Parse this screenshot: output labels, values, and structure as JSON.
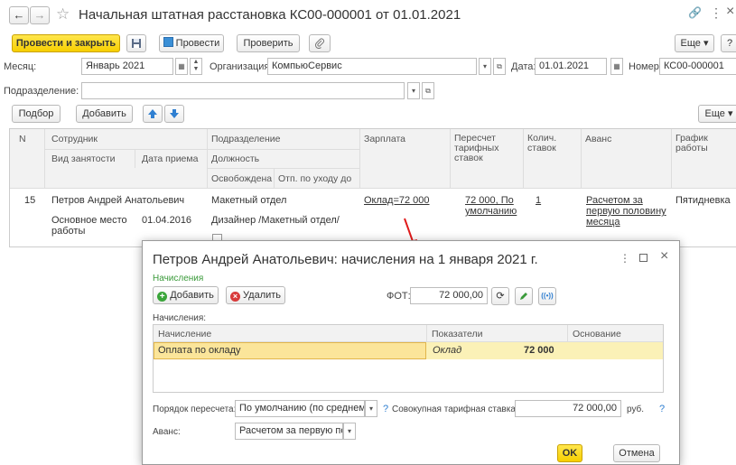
{
  "window": {
    "title": "Начальная штатная расстановка КС00-000001 от 01.01.2021",
    "nav_back": "←",
    "nav_forward": "→",
    "star": "☆",
    "link_icon": "🔗",
    "more_icon": "⋮",
    "close_icon": "×"
  },
  "toolbar": {
    "post_close": "Провести и закрыть",
    "save_icon": "save",
    "post": "Провести",
    "check": "Проверить",
    "attach_icon": "paperclip",
    "more": "Еще",
    "help": "?"
  },
  "header": {
    "month_label": "Месяц:",
    "month_value": "Январь 2021",
    "org_label": "Организация:",
    "org_value": "КомпьюСервис",
    "date_label": "Дата:",
    "date_value": "01.01.2021",
    "number_label": "Номер:",
    "number_value": "КС00-000001",
    "dept_label": "Подразделение:",
    "dept_value": ""
  },
  "table_toolbar": {
    "select": "Подбор",
    "add": "Добавить",
    "more": "Еще"
  },
  "table": {
    "headers": {
      "n": "N",
      "employee": "Сотрудник",
      "employment": "Вид занятости",
      "hire_date": "Дата приема",
      "department": "Подразделение",
      "position": "Должность",
      "vacated": "Освобождена",
      "leave": "Отп. по уходу до",
      "salary": "Зарплата",
      "recalc": "Пересчет тарифных ставок",
      "rates": "Колич. ставок",
      "advance": "Аванс",
      "schedule": "График работы"
    },
    "row": {
      "n": "15",
      "employee": "Петров Андрей Анатольевич",
      "employment": "Основное место работы",
      "hire_date": "01.04.2016",
      "department": "Макетный отдел",
      "position": "Дизайнер /Макетный отдел/",
      "salary": "Оклад=72 000",
      "recalc": "72 000, По умолчанию",
      "rates": "1",
      "advance": "Расчетом за первую половину месяца",
      "schedule": "Пятидневка"
    }
  },
  "dialog": {
    "title": "Петров Андрей Анатольевич: начисления на 1 января 2021 г.",
    "section": "Начисления",
    "add": "Добавить",
    "delete": "Удалить",
    "fot_label": "ФОТ:",
    "fot_value": "72 000,00",
    "list_label": "Начисления:",
    "headers": {
      "accrual": "Начисление",
      "indicators": "Показатели",
      "basis": "Основание"
    },
    "row": {
      "accrual": "Оплата по окладу",
      "indicator": "Оклад",
      "value": "72 000",
      "basis": ""
    },
    "recalc_label": "Порядок пересчета:",
    "recalc_value": "По умолчанию (по среднемеся",
    "rate_label": "Совокупная тарифная ставка:",
    "rate_value": "72 000,00",
    "rate_unit": "руб.",
    "advance_label": "Аванс:",
    "advance_value": "Расчетом за первую полс",
    "ok": "OK",
    "cancel": "Отмена",
    "q": "?"
  },
  "colors": {
    "accent_yellow": "#f7d21e",
    "selected_row": "#fbf1b7",
    "link_green": "#3a9a3a",
    "arrow_red": "#e01b1b"
  }
}
